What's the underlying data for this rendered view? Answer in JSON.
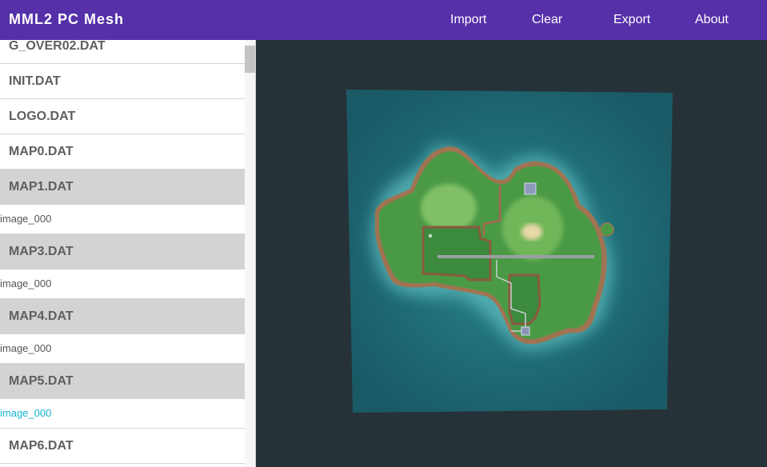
{
  "header": {
    "title": "MML2 PC Mesh",
    "menu": [
      "Import",
      "Clear",
      "Export",
      "About"
    ]
  },
  "sidebar": {
    "files": [
      {
        "name": "G_OVER02.DAT"
      },
      {
        "name": "INIT.DAT"
      },
      {
        "name": "LOGO.DAT"
      },
      {
        "name": "MAP0.DAT"
      },
      {
        "name": "MAP1.DAT",
        "expanded": true,
        "child": "image_000"
      },
      {
        "name": "MAP3.DAT",
        "expanded": true,
        "child": "image_000"
      },
      {
        "name": "MAP4.DAT",
        "expanded": true,
        "child": "image_000"
      },
      {
        "name": "MAP5.DAT",
        "expanded": true,
        "child": "image_000",
        "selected": true
      },
      {
        "name": "MAP6.DAT"
      }
    ]
  },
  "colors": {
    "header": "#5530a9",
    "viewport": "#263238",
    "selected_text": "#17b3cf",
    "open_row": "#d3d3d3"
  },
  "icons": [
    "scrollbar-thumb"
  ]
}
